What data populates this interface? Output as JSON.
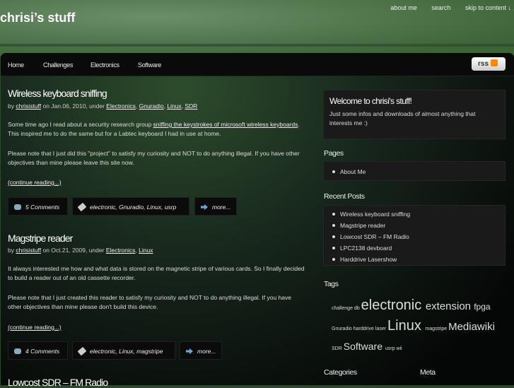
{
  "site": {
    "title": "chrisi’s stuff",
    "top_links": [
      "about me",
      "search",
      "skip to content ↓"
    ]
  },
  "nav": {
    "items": [
      "Home",
      "Challenges",
      "Electronics",
      "Software"
    ],
    "rss_label": "rss"
  },
  "posts": [
    {
      "title": "Wireless keyboard sniffing",
      "by": "by",
      "author": "chrisistuff",
      "on": "on Jan.06, 2010, under",
      "cats": [
        "Electronics",
        "Gnuradio",
        "Linux",
        "SDR"
      ],
      "p1_pre": "Some time ago I read about a security research group ",
      "p1_link": "sniffing the keystrokes of microsoft wireless keyboards",
      "p1_post": ". This inspired me to do the same but for a Labtec keyboard I had in use at home.",
      "p2": "Please note that I just did this \"project\" to satisfy my curiosity and NOT to do anything illegal. If you have other objectives than mine please leave this site now.",
      "continue": "(continue reading...)",
      "comments": "5 Comments",
      "tags": "electronic, Gnuradio, Linux, usrp",
      "more": "more..."
    },
    {
      "title": "Magstripe reader",
      "by": "by",
      "author": "chrisistuff",
      "on": "on Oct.21, 2009, under",
      "cats": [
        "Electronics",
        "Linux"
      ],
      "p1_pre": "It always interested me how and what data is stored on the magnetic stripe of various cards. So I finally decided to build a reader out of an old cassette recorder.",
      "p1_link": "",
      "p1_post": "",
      "p2": "Please note that I just created this reader to satisfy my curiosity and NOT to do anything illegal. If you have other objectives than mine please don't build this device.",
      "continue": "(continue reading...)",
      "comments": "4 Comments",
      "tags": "electronic, Linux, magstripe",
      "more": "more..."
    },
    {
      "title": "Lowcost SDR – FM Radio"
    }
  ],
  "sidebar": {
    "welcome_title": "Welcome to chrisi's stuff!",
    "welcome_text": "Just some infos and downloads of almost anything that interests me :)",
    "pages_title": "Pages",
    "pages": [
      "About Me"
    ],
    "recent_title": "Recent Posts",
    "recent": [
      "Wireless keyboard sniffing",
      "Magstripe reader",
      "Lowcost SDR – FM Radio",
      "LPC2138 devboard",
      "Harddrive Lasershow"
    ],
    "tags_title": "Tags",
    "tags": [
      {
        "t": "challenge",
        "s": 7
      },
      {
        "t": "db",
        "s": 7
      },
      {
        "t": "electronic",
        "s": 20
      },
      {
        "t": "extension",
        "s": 15
      },
      {
        "t": "fpga",
        "s": 12
      },
      {
        "t": "Gnuradio",
        "s": 7
      },
      {
        "t": "harddrive",
        "s": 7
      },
      {
        "t": "laser",
        "s": 7
      },
      {
        "t": "Linux",
        "s": 20
      },
      {
        "t": "magstripe",
        "s": 7
      },
      {
        "t": "Mediawiki",
        "s": 15
      },
      {
        "t": "SDR",
        "s": 7
      },
      {
        "t": "Software",
        "s": 14
      },
      {
        "t": "usrp",
        "s": 7
      },
      {
        "t": "wii",
        "s": 7
      }
    ],
    "categories_title": "Categories",
    "meta_title": "Meta"
  }
}
